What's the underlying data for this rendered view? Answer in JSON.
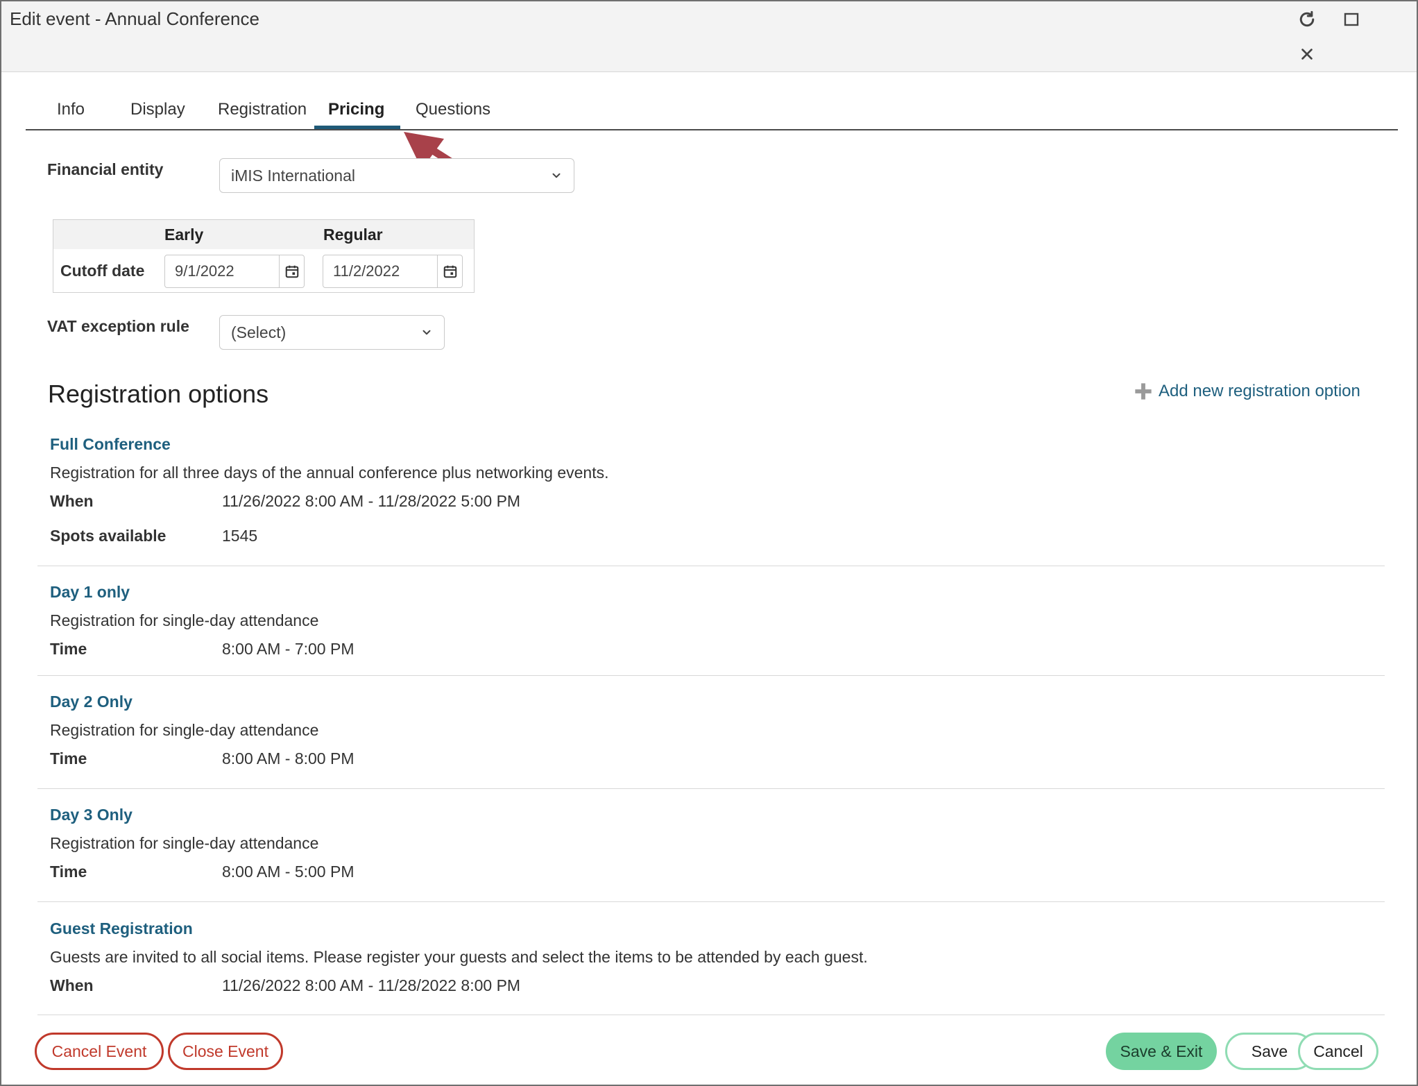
{
  "window": {
    "title": "Edit event - Annual Conference"
  },
  "tabs": [
    {
      "label": "Info"
    },
    {
      "label": "Display"
    },
    {
      "label": "Registration"
    },
    {
      "label": "Pricing",
      "active": true
    },
    {
      "label": "Questions"
    }
  ],
  "financial_entity": {
    "label": "Financial entity",
    "value": "iMIS International"
  },
  "cutoff": {
    "row_label": "Cutoff date",
    "early_label": "Early",
    "regular_label": "Regular",
    "early_value": "9/1/2022",
    "regular_value": "11/2/2022"
  },
  "vat": {
    "label": "VAT exception rule",
    "value": "(Select)"
  },
  "registration_options": {
    "title": "Registration options",
    "add_label": "Add new registration option",
    "items": [
      {
        "name": "Full Conference",
        "description": "Registration for all three days of the annual conference plus networking events.",
        "rows": [
          {
            "label": "When",
            "value": "11/26/2022 8:00 AM - 11/28/2022 5:00 PM"
          },
          {
            "label": "Spots available",
            "value": "1545"
          }
        ]
      },
      {
        "name": "Day 1 only",
        "description": "Registration for single-day attendance",
        "rows": [
          {
            "label": "Time",
            "value": "8:00 AM - 7:00 PM"
          }
        ]
      },
      {
        "name": "Day 2 Only",
        "description": "Registration for single-day attendance",
        "rows": [
          {
            "label": "Time",
            "value": "8:00 AM - 8:00 PM"
          }
        ]
      },
      {
        "name": "Day 3 Only",
        "description": "Registration for single-day attendance",
        "rows": [
          {
            "label": "Time",
            "value": "8:00 AM - 5:00 PM"
          }
        ]
      },
      {
        "name": "Guest Registration",
        "description": "Guests are invited to all social items. Please register your guests and select the items to be attended by each guest.",
        "rows": [
          {
            "label": "When",
            "value": "11/26/2022 8:00 AM - 11/28/2022 8:00 PM"
          }
        ]
      }
    ]
  },
  "footer": {
    "cancel_event": "Cancel Event",
    "close_event": "Close Event",
    "save_exit": "Save & Exit",
    "save": "Save",
    "cancel": "Cancel"
  },
  "colors": {
    "link": "#1e5f7e",
    "danger": "#c0392b",
    "success": "#74d3a0",
    "annotation_arrow": "#a8414a"
  },
  "icons": [
    "refresh-icon",
    "maximize-icon",
    "close-icon",
    "calendar-icon",
    "chevron-down-icon",
    "plus-icon",
    "annotation-arrow"
  ]
}
